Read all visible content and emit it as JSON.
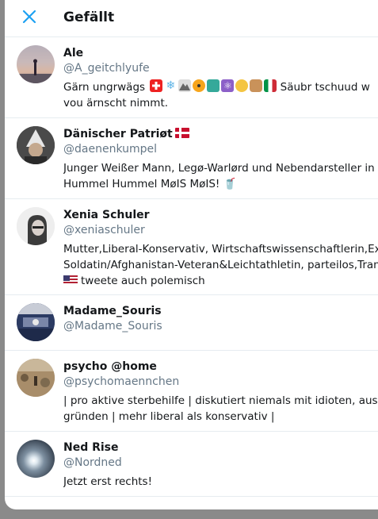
{
  "header": {
    "title": "Gefällt",
    "close_icon": "close-icon"
  },
  "users": [
    {
      "name": "Ale",
      "handle": "@A_geitchlyufe",
      "bio_lines": [
        "Gärn ungrwägs",
        "Säubr tschuud w",
        "vou ärnscht nimmt."
      ],
      "avatar": "sunset-silhouette"
    },
    {
      "name": "Dänischer Patriøt",
      "name_flag": "flag-denmark",
      "handle": "@daenenkumpel",
      "bio_lines": [
        "Junger Weißer Mann, Legø-Warlørd und Nebendarsteller in",
        "Hummel Hummel MøIS MøIS! 🥤"
      ],
      "avatar": "gnome-hat"
    },
    {
      "name": "Xenia Schuler",
      "handle": "@xeniaschuler",
      "bio_lines": [
        "Mutter,Liberal-Konservativ, Wirtschaftswissenschaftlerin,Ex-",
        "Soldatin/Afghanistan-Veteran&Leichtathletin, parteilos,Trans",
        "tweete auch polemisch"
      ],
      "bio_flag": "flag-usa",
      "avatar": "woman-glasses"
    },
    {
      "name": "Madame_Souris",
      "handle": "@Madame_Souris",
      "bio_lines": [],
      "avatar": "parliament-hall"
    },
    {
      "name": "psycho @home",
      "handle": "@psychomaennchen",
      "bio_lines": [
        "| pro aktive sterbehilfe | diskutiert niemals mit idioten, aus de",
        "gründen | mehr liberal als konservativ |"
      ],
      "avatar": "landscape-figure"
    },
    {
      "name": "Ned Rise",
      "handle": "@Nordned",
      "bio_lines": [
        "Jetzt erst rechts!"
      ],
      "avatar": "lens-flare"
    }
  ],
  "colors": {
    "text_primary": "#14171a",
    "text_secondary": "#657786",
    "accent": "#1da1f2",
    "divider": "#e6ecf0"
  }
}
